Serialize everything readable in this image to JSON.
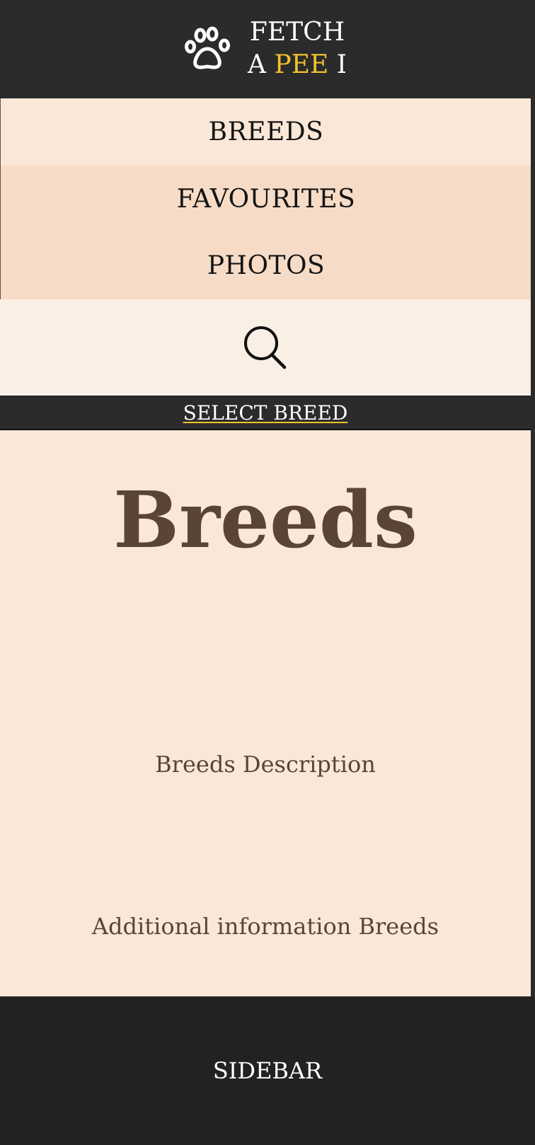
{
  "header": {
    "brand_line1": "FETCH",
    "brand_line2_a": "A",
    "brand_line2_accent": "PEE",
    "brand_line2_b": "I",
    "logo_icon": "paw-icon",
    "accent_color": "#f2c12e"
  },
  "nav": {
    "items": [
      {
        "label": "BREEDS"
      },
      {
        "label": "FAVOURITES"
      },
      {
        "label": "PHOTOS"
      }
    ]
  },
  "search": {
    "icon": "search-icon"
  },
  "select_breed": {
    "label": "SELECT BREED"
  },
  "main": {
    "title": "Breeds",
    "description": "Breeds Description",
    "additional": "Additional information Breeds"
  },
  "sidebar": {
    "label": "SIDEBAR"
  }
}
